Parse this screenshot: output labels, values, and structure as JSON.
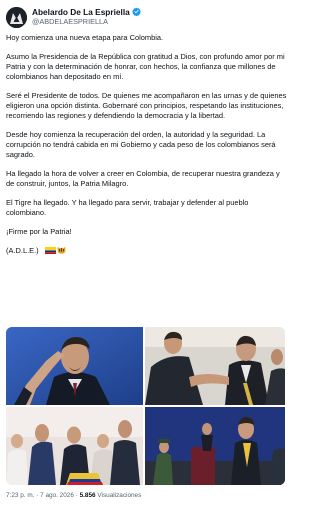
{
  "author": {
    "name": "Abelardo De La Espriella",
    "handle": "@ABDELAESPRIELLA",
    "verified": true,
    "avatar_icon": "profile-avatar-icon"
  },
  "post": {
    "paragraphs": [
      "Hoy comienza una nueva etapa para Colombia.",
      "Asumo la Presidencia de la República con gratitud a Dios, con profundo amor por mi Patria y con la determinación de honrar, con hechos, la confianza que millones de colombianos han depositado en mí.",
      "Seré el Presidente de todos. De quienes me acompañaron en las urnas y de quienes eligieron una opción distinta. Gobernaré con principios, respetando las instituciones, recorriendo las regiones y defendiendo la democracia y la libertad.",
      "Desde hoy comienza la recuperación del orden, la autoridad y la seguridad. La corrupción no tendrá cabida en mi Gobierno y cada peso de los colombianos será sagrado.",
      "Ha llegado la hora de volver a creer en Colombia, de recuperar nuestra grandeza y de construir, juntos, la Patria Milagro.",
      "El Tigre ha llegado. Y ha llegado para servir, trabajar y defender al pueblo colombiano.",
      "¡Firme por la Patria!"
    ],
    "signature": "(A.D.L.E.)",
    "signature_icons": [
      "colombia-flag-icon",
      "tiger-icon"
    ]
  },
  "media": {
    "images": [
      "salute-photo",
      "handshake-photo",
      "crowd-photo",
      "ceremony-photo"
    ]
  },
  "footer": {
    "time": "7:23 p. m.",
    "sep": "·",
    "date": "7 ago. 2026",
    "views_count": "5.856",
    "views_label": "Visualizaciones"
  },
  "colors": {
    "text": "#0f1419",
    "secondary": "#536471",
    "verified": "#1d9bf0"
  }
}
